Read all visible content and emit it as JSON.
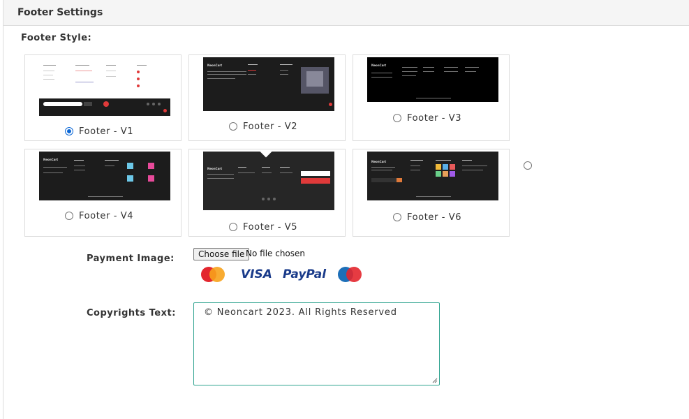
{
  "panel": {
    "title": "Footer Settings"
  },
  "footer_style": {
    "label": "Footer Style:",
    "options": [
      {
        "label": "Footer - V1",
        "selected": true
      },
      {
        "label": "Footer - V2",
        "selected": false
      },
      {
        "label": "Footer - V3",
        "selected": false
      },
      {
        "label": "Footer - V4",
        "selected": false
      },
      {
        "label": "Footer - V5",
        "selected": false
      },
      {
        "label": "Footer - V6",
        "selected": false
      }
    ],
    "thumb_brand": "NeonCart"
  },
  "payment_image": {
    "label": "Payment Image:",
    "button_label": "Choose file",
    "status": "No file chosen",
    "logos": {
      "mastercard": "MasterCard",
      "visa": "VISA",
      "paypal": "PayPal",
      "maestro": "Maestro"
    }
  },
  "copyrights": {
    "label": "Copyrights Text:",
    "value": "© Neoncart 2023. All Rights Reserved"
  },
  "colors": {
    "accent_radio": "#0b67d6",
    "textarea_border": "#2ea38f",
    "brand_red": "#e03a3a"
  }
}
